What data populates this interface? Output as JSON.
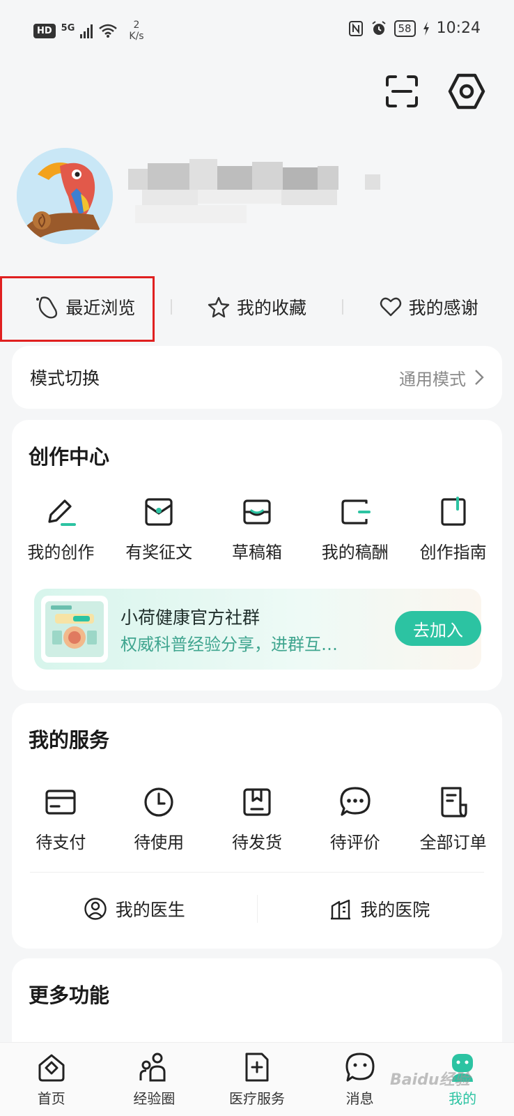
{
  "status_bar": {
    "hd": "HD",
    "network": "5G",
    "speed_value": "2",
    "speed_unit": "K/s",
    "battery": "58",
    "time": "10:24"
  },
  "quick_links": {
    "recent": "最近浏览",
    "favorites": "我的收藏",
    "thanks": "我的感谢"
  },
  "mode_switch": {
    "label": "模式切换",
    "value": "通用模式"
  },
  "create_center": {
    "title": "创作中心",
    "items": [
      {
        "label": "我的创作",
        "icon": "pen-icon"
      },
      {
        "label": "有奖征文",
        "icon": "prize-envelope-icon"
      },
      {
        "label": "草稿箱",
        "icon": "draft-box-icon"
      },
      {
        "label": "我的稿酬",
        "icon": "wallet-icon"
      },
      {
        "label": "创作指南",
        "icon": "guide-book-icon"
      }
    ],
    "banner": {
      "title": "小荷健康官方社群",
      "subtitle": "权威科普经验分享，进群互…",
      "button": "去加入"
    }
  },
  "my_services": {
    "title": "我的服务",
    "items": [
      {
        "label": "待支付",
        "icon": "card-icon"
      },
      {
        "label": "待使用",
        "icon": "clock-icon"
      },
      {
        "label": "待发货",
        "icon": "package-icon"
      },
      {
        "label": "待评价",
        "icon": "comment-icon"
      },
      {
        "label": "全部订单",
        "icon": "order-list-icon"
      }
    ],
    "doctor": "我的医生",
    "hospital": "我的医院"
  },
  "more_functions": {
    "title": "更多功能"
  },
  "bottom_nav": [
    {
      "label": "首页",
      "icon": "home-icon"
    },
    {
      "label": "经验圈",
      "icon": "community-icon"
    },
    {
      "label": "医疗服务",
      "icon": "medical-icon"
    },
    {
      "label": "消息",
      "icon": "message-icon"
    },
    {
      "label": "我的",
      "icon": "profile-icon",
      "active": true
    }
  ],
  "watermark": "Baidu经验",
  "colors": {
    "accent": "#2cc3a2",
    "highlight_box": "#e02020",
    "background": "#f5f6f7"
  }
}
